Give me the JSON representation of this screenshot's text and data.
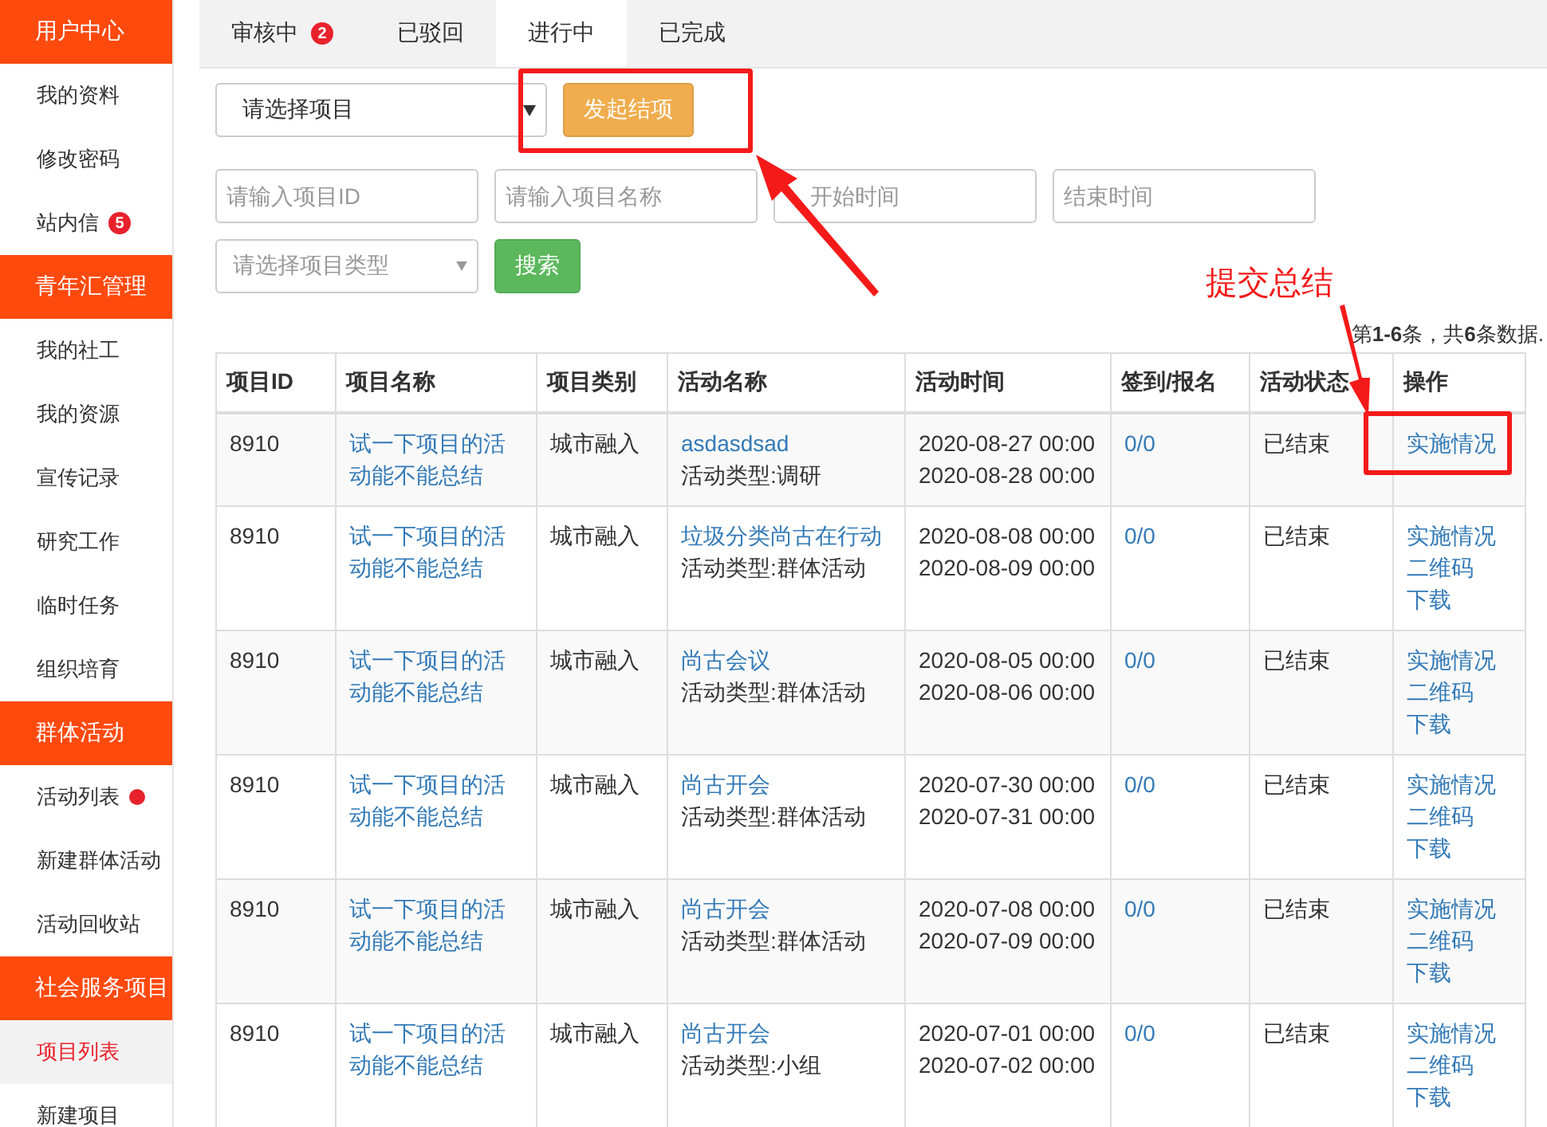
{
  "sidebar": [
    {
      "header": "用户中心",
      "items": [
        {
          "label": "我的资料",
          "selected": false
        },
        {
          "label": "修改密码",
          "selected": false
        },
        {
          "label": "站内信",
          "selected": false,
          "badge": "5"
        }
      ]
    },
    {
      "header": "青年汇管理",
      "items": [
        {
          "label": "我的社工",
          "selected": false
        },
        {
          "label": "我的资源",
          "selected": false
        },
        {
          "label": "宣传记录",
          "selected": false
        },
        {
          "label": "研究工作",
          "selected": false
        },
        {
          "label": "临时任务",
          "selected": false
        },
        {
          "label": "组织培育",
          "selected": false
        }
      ]
    },
    {
      "header": "群体活动",
      "items": [
        {
          "label": "活动列表",
          "selected": false,
          "dot": true
        },
        {
          "label": "新建群体活动",
          "selected": false
        },
        {
          "label": "活动回收站",
          "selected": false
        }
      ]
    },
    {
      "header": "社会服务项目",
      "items": [
        {
          "label": "项目列表",
          "selected": true
        },
        {
          "label": "新建项目",
          "selected": false
        }
      ]
    }
  ],
  "tabs": [
    {
      "label": "审核中",
      "selected": false,
      "badge": "2"
    },
    {
      "label": "已驳回",
      "selected": false
    },
    {
      "label": "进行中",
      "selected": true
    },
    {
      "label": "已完成",
      "selected": false
    }
  ],
  "toolbar": {
    "project_select": {
      "placeholder": "请选择项目"
    },
    "start_button": "发起结项"
  },
  "filters": {
    "project_id": {
      "placeholder": "请输入项目ID"
    },
    "project_name": {
      "placeholder": "请输入项目名称"
    },
    "start_time": {
      "placeholder": "开始时间"
    },
    "end_time": {
      "placeholder": "结束时间"
    },
    "type_select": {
      "placeholder": "请选择项目类型"
    },
    "search_button": "搜索"
  },
  "summary": "第**1-6**条，共**6**条数据.",
  "table": {
    "columns": [
      "项目ID",
      "项目名称",
      "项目类别",
      "活动名称",
      "活动时间",
      "签到/报名",
      "活动状态",
      "操作"
    ],
    "rows": [
      {
        "id": "8910",
        "project_name": "试一下项目的活动能不能总结",
        "category": "城市融入",
        "activity_name": "asdasdsad",
        "activity_type": "活动类型:调研",
        "start": "2020-08-27 00:00",
        "end": "2020-08-28 00:00",
        "signup": "0/0",
        "status": "已结束",
        "actions": [
          "实施情况"
        ]
      },
      {
        "id": "8910",
        "project_name": "试一下项目的活动能不能总结",
        "category": "城市融入",
        "activity_name": "垃圾分类尚古在行动",
        "activity_type": "活动类型:群体活动",
        "start": "2020-08-08 00:00",
        "end": "2020-08-09 00:00",
        "signup": "0/0",
        "status": "已结束",
        "actions": [
          "实施情况",
          "二维码",
          "下载"
        ]
      },
      {
        "id": "8910",
        "project_name": "试一下项目的活动能不能总结",
        "category": "城市融入",
        "activity_name": "尚古会议",
        "activity_type": "活动类型:群体活动",
        "start": "2020-08-05 00:00",
        "end": "2020-08-06 00:00",
        "signup": "0/0",
        "status": "已结束",
        "actions": [
          "实施情况",
          "二维码",
          "下载"
        ]
      },
      {
        "id": "8910",
        "project_name": "试一下项目的活动能不能总结",
        "category": "城市融入",
        "activity_name": "尚古开会",
        "activity_type": "活动类型:群体活动",
        "start": "2020-07-30 00:00",
        "end": "2020-07-31 00:00",
        "signup": "0/0",
        "status": "已结束",
        "actions": [
          "实施情况",
          "二维码",
          "下载"
        ]
      },
      {
        "id": "8910",
        "project_name": "试一下项目的活动能不能总结",
        "category": "城市融入",
        "activity_name": "尚古开会",
        "activity_type": "活动类型:群体活动",
        "start": "2020-07-08 00:00",
        "end": "2020-07-09 00:00",
        "signup": "0/0",
        "status": "已结束",
        "actions": [
          "实施情况",
          "二维码",
          "下载"
        ]
      },
      {
        "id": "8910",
        "project_name": "试一下项目的活动能不能总结",
        "category": "城市融入",
        "activity_name": "尚古开会",
        "activity_type": "活动类型:小组",
        "start": "2020-07-01 00:00",
        "end": "2020-07-02 00:00",
        "signup": "0/0",
        "status": "已结束",
        "actions": [
          "实施情况",
          "二维码",
          "下载"
        ]
      }
    ]
  },
  "annotation": {
    "label": "提交总结"
  }
}
